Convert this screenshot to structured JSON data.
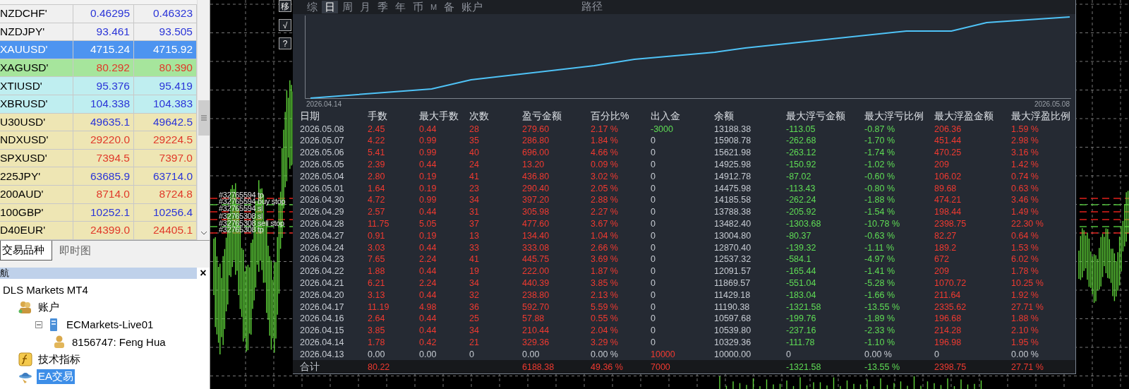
{
  "market_watch": {
    "rows": [
      {
        "symbol": "NZDCHF'",
        "bid": "0.46295",
        "ask": "0.46323",
        "color": "#f0f0f0",
        "rising": true,
        "selected": false
      },
      {
        "symbol": "NZDJPY'",
        "bid": "93.461",
        "ask": "93.505",
        "color": "#f0f0f0",
        "rising": true,
        "selected": false
      },
      {
        "symbol": "XAUUSD'",
        "bid": "4715.24",
        "ask": "4715.92",
        "color": "#4d94f0",
        "selected": true
      },
      {
        "symbol": "XAGUSD'",
        "bid": "80.292",
        "ask": "80.390",
        "color": "#a6e59c",
        "rising": false,
        "selected": false
      },
      {
        "symbol": "XTIUSD'",
        "bid": "95.376",
        "ask": "95.419",
        "color": "#bfeef0",
        "rising": true,
        "selected": false
      },
      {
        "symbol": "XBRUSD'",
        "bid": "104.338",
        "ask": "104.383",
        "color": "#bfeef0",
        "rising": true,
        "selected": false
      },
      {
        "symbol": "U30USD'",
        "bid": "49635.1",
        "ask": "49642.5",
        "color": "#eee6b4",
        "rising": true,
        "selected": false
      },
      {
        "symbol": "NDXUSD'",
        "bid": "29220.0",
        "ask": "29224.5",
        "color": "#eee6b4",
        "rising": false,
        "selected": false
      },
      {
        "symbol": "SPXUSD'",
        "bid": "7394.5",
        "ask": "7397.0",
        "color": "#eee6b4",
        "rising": false,
        "selected": false
      },
      {
        "symbol": "225JPY'",
        "bid": "63685.9",
        "ask": "63714.0",
        "color": "#eee6b4",
        "rising": true,
        "selected": false
      },
      {
        "symbol": "200AUD'",
        "bid": "8714.0",
        "ask": "8724.8",
        "color": "#eee6b4",
        "rising": false,
        "selected": false
      },
      {
        "symbol": "100GBP'",
        "bid": "10252.1",
        "ask": "10256.4",
        "color": "#eee6b4",
        "rising": true,
        "selected": false
      },
      {
        "symbol": "D40EUR'",
        "bid": "24399.0",
        "ask": "24405.1",
        "color": "#eee6b4",
        "rising": false,
        "selected": false
      }
    ],
    "tabs": [
      {
        "label": "交易品种",
        "selected": true
      },
      {
        "label": "即时图",
        "selected": false
      }
    ]
  },
  "navigator": {
    "title": "航",
    "close": "×",
    "tree": [
      {
        "label": "DLS Markets MT4",
        "selected": false,
        "children": [
          {
            "label": "账户",
            "kind": "accounts",
            "selected": false,
            "children": [
              {
                "label": "ECMarkets-Live01",
                "kind": "server",
                "selected": false,
                "expanded": true,
                "children": [
                  {
                    "label": "8156747: Feng Hua",
                    "kind": "account",
                    "selected": false
                  }
                ]
              }
            ]
          },
          {
            "label": "技术指标",
            "kind": "indicators",
            "selected": false
          },
          {
            "label": "EA交易",
            "kind": "experts",
            "selected": true
          }
        ]
      }
    ]
  },
  "chart": {
    "orders": [
      {
        "label": "#32765594 tp",
        "kind": "limit"
      },
      {
        "label": "#32765594 buy stop",
        "kind": "pending"
      },
      {
        "label": "#32765594 sl",
        "kind": "limit"
      },
      {
        "label": "#32765308 sl",
        "kind": "limit"
      },
      {
        "label": "#32765308 sell stop",
        "kind": "pending"
      },
      {
        "label": "#32765308 tp",
        "kind": "limit"
      }
    ],
    "tool_buttons": [
      "移",
      "√",
      "?"
    ]
  },
  "report": {
    "tabs": [
      {
        "label": "综",
        "selected": false
      },
      {
        "label": "日",
        "selected": true
      },
      {
        "label": "周",
        "selected": false
      },
      {
        "label": "月",
        "selected": false
      },
      {
        "label": "季",
        "selected": false
      },
      {
        "label": "年",
        "selected": false
      },
      {
        "label": "币",
        "selected": false
      },
      {
        "label": "M",
        "selected": false
      },
      {
        "label": "备",
        "selected": false
      },
      {
        "label": "账户",
        "selected": false
      }
    ],
    "path_button": "路径",
    "equity_chart": {
      "start_date": "2026.04.14",
      "end_date": "2026.05.08"
    },
    "table": {
      "columns": [
        "日期",
        "手数",
        "最大手数",
        "次数",
        "盈亏金额",
        "百分比%",
        "出入金",
        "余额",
        "最大浮亏金额",
        "最大浮亏比例",
        "最大浮盈金额",
        "最大浮盈比例"
      ],
      "rows": [
        {
          "kind": "withdrawal",
          "cells": [
            "2026.05.08",
            "2.45",
            "0.44",
            "28",
            "279.60",
            "2.17 %",
            "-3000",
            "13188.38",
            "-113.05",
            "-0.87 %",
            "206.36",
            "1.59 %"
          ]
        },
        {
          "kind": "trading",
          "cells": [
            "2026.05.07",
            "4.22",
            "0.99",
            "35",
            "286.80",
            "1.84 %",
            "0",
            "15908.78",
            "-262.68",
            "-1.70 %",
            "451.44",
            "2.98 %"
          ]
        },
        {
          "kind": "trading",
          "cells": [
            "2026.05.06",
            "5.41",
            "0.99",
            "40",
            "696.00",
            "4.66 %",
            "0",
            "15621.98",
            "-263.12",
            "-1.74 %",
            "470.25",
            "3.16 %"
          ]
        },
        {
          "kind": "trading",
          "cells": [
            "2026.05.05",
            "2.39",
            "0.44",
            "24",
            "13.20",
            "0.09 %",
            "0",
            "14925.98",
            "-150.92",
            "-1.02 %",
            "209",
            "1.42 %"
          ]
        },
        {
          "kind": "trading",
          "cells": [
            "2026.05.04",
            "2.80",
            "0.19",
            "41",
            "436.80",
            "3.02 %",
            "0",
            "14912.78",
            "-87.02",
            "-0.60 %",
            "106.02",
            "0.74 %"
          ]
        },
        {
          "kind": "trading",
          "cells": [
            "2026.05.01",
            "1.64",
            "0.19",
            "23",
            "290.40",
            "2.05 %",
            "0",
            "14475.98",
            "-113.43",
            "-0.80 %",
            "89.68",
            "0.63 %"
          ]
        },
        {
          "kind": "trading",
          "cells": [
            "2026.04.30",
            "4.72",
            "0.99",
            "34",
            "397.20",
            "2.88 %",
            "0",
            "14185.58",
            "-262.24",
            "-1.88 %",
            "474.21",
            "3.46 %"
          ]
        },
        {
          "kind": "trading",
          "cells": [
            "2026.04.29",
            "2.57",
            "0.44",
            "31",
            "305.98",
            "2.27 %",
            "0",
            "13788.38",
            "-205.92",
            "-1.54 %",
            "198.44",
            "1.49 %"
          ]
        },
        {
          "kind": "trading",
          "cells": [
            "2026.04.28",
            "11.75",
            "5.05",
            "37",
            "477.60",
            "3.67 %",
            "0",
            "13482.40",
            "-1303.68",
            "-10.78 %",
            "2398.75",
            "22.30 %"
          ]
        },
        {
          "kind": "trading",
          "cells": [
            "2026.04.27",
            "0.91",
            "0.19",
            "13",
            "134.40",
            "1.04 %",
            "0",
            "13004.80",
            "-80.37",
            "-0.63 %",
            "82.27",
            "0.64 %"
          ]
        },
        {
          "kind": "trading",
          "cells": [
            "2026.04.24",
            "3.03",
            "0.44",
            "33",
            "333.08",
            "2.66 %",
            "0",
            "12870.40",
            "-139.32",
            "-1.11 %",
            "189.2",
            "1.53 %"
          ]
        },
        {
          "kind": "trading",
          "cells": [
            "2026.04.23",
            "7.65",
            "2.24",
            "41",
            "445.75",
            "3.69 %",
            "0",
            "12537.32",
            "-584.1",
            "-4.97 %",
            "672",
            "6.02 %"
          ]
        },
        {
          "kind": "trading",
          "cells": [
            "2026.04.22",
            "1.88",
            "0.44",
            "19",
            "222.00",
            "1.87 %",
            "0",
            "12091.57",
            "-165.44",
            "-1.41 %",
            "209",
            "1.78 %"
          ]
        },
        {
          "kind": "trading",
          "cells": [
            "2026.04.21",
            "6.21",
            "2.24",
            "34",
            "440.39",
            "3.85 %",
            "0",
            "11869.57",
            "-551.04",
            "-5.28 %",
            "1070.72",
            "10.25 %"
          ]
        },
        {
          "kind": "trading",
          "cells": [
            "2026.04.20",
            "3.13",
            "0.44",
            "32",
            "238.80",
            "2.13 %",
            "0",
            "11429.18",
            "-183.04",
            "-1.66 %",
            "211.64",
            "1.92 %"
          ]
        },
        {
          "kind": "trading",
          "cells": [
            "2026.04.17",
            "11.19",
            "4.98",
            "36",
            "592.70",
            "5.59 %",
            "0",
            "11190.38",
            "-1321.58",
            "-13.55 %",
            "2335.62",
            "27.71 %"
          ]
        },
        {
          "kind": "trading",
          "cells": [
            "2026.04.16",
            "2.64",
            "0.44",
            "25",
            "57.88",
            "0.55 %",
            "0",
            "10597.68",
            "-199.76",
            "-1.89 %",
            "196.68",
            "1.88 %"
          ]
        },
        {
          "kind": "trading",
          "cells": [
            "2026.04.15",
            "3.85",
            "0.44",
            "34",
            "210.44",
            "2.04 %",
            "0",
            "10539.80",
            "-237.16",
            "-2.33 %",
            "214.28",
            "2.10 %"
          ]
        },
        {
          "kind": "trading",
          "cells": [
            "2026.04.14",
            "1.78",
            "0.42",
            "21",
            "329.36",
            "3.29 %",
            "0",
            "10329.36",
            "-111.78",
            "-1.10 %",
            "196.98",
            "1.95 %"
          ]
        },
        {
          "kind": "opening",
          "cells": [
            "2026.04.13",
            "0.00",
            "0.00",
            "0",
            "0.00",
            "0.00 %",
            "10000",
            "10000.00",
            "0",
            "0.00 %",
            "0",
            "0.00 %"
          ]
        }
      ],
      "total": {
        "label": "合计",
        "lots": "80.22",
        "pnl": "6188.38",
        "percent": "49.36 %",
        "deposit": "7000",
        "max_loss": "-1321.58",
        "max_loss_ratio": "-13.55 %",
        "max_profit": "2398.75",
        "max_profit_ratio": "27.71 %"
      }
    }
  }
}
